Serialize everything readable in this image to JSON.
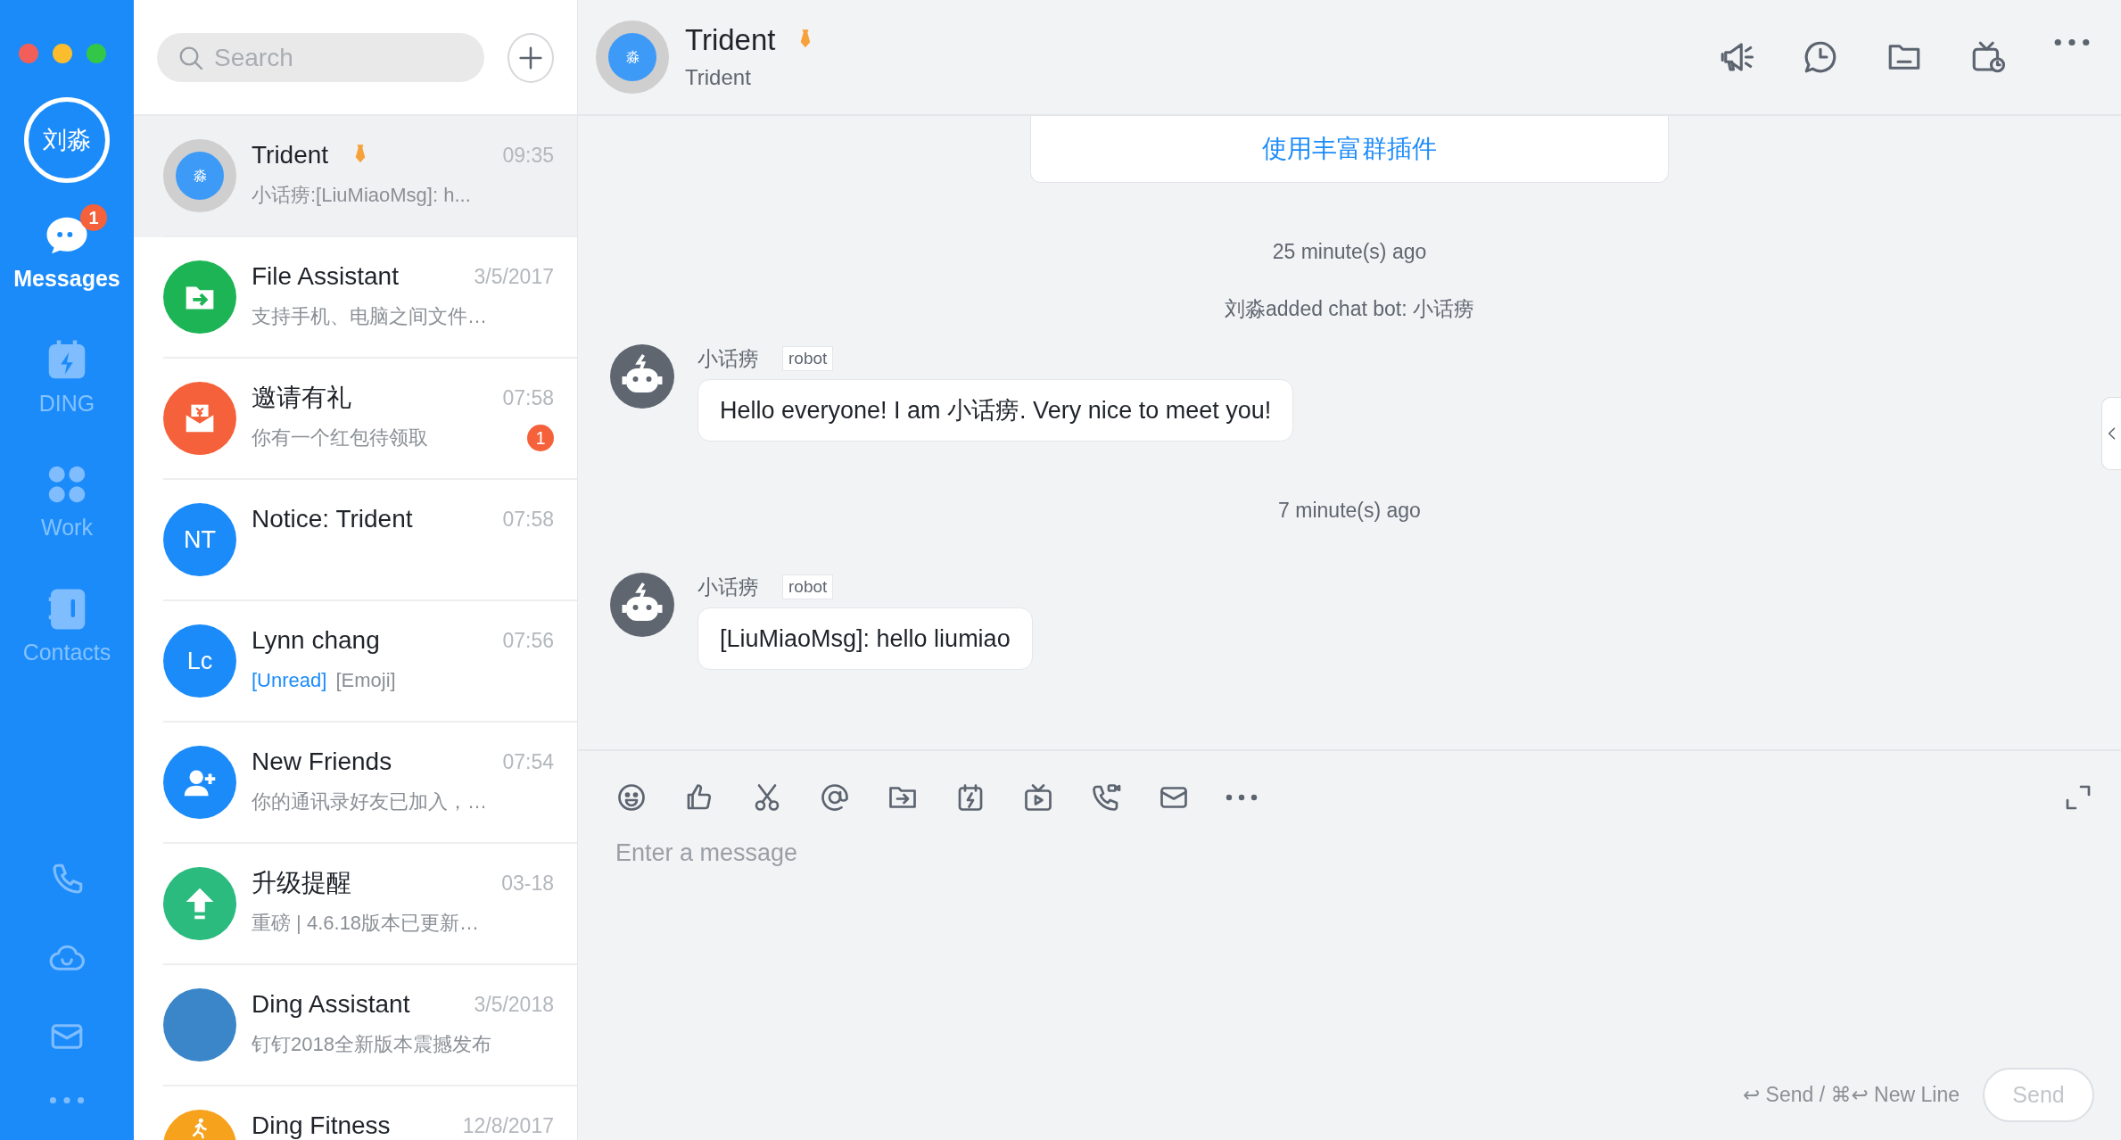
{
  "sidebar": {
    "user_avatar": "刘淼",
    "items": [
      {
        "kind": "messages",
        "label": "Messages",
        "badge": "1",
        "selected": true
      },
      {
        "kind": "ding",
        "label": "DING",
        "selected": false
      },
      {
        "kind": "work",
        "label": "Work",
        "selected": false
      },
      {
        "kind": "contacts",
        "label": "Contacts",
        "selected": false
      }
    ]
  },
  "search": {
    "placeholder": "Search"
  },
  "conversations": [
    {
      "kind": "group",
      "avatar_text": "淼",
      "color": "#3d9bf7",
      "name": "Trident",
      "marked": true,
      "time": "09:35",
      "preview": "小话痨:[LiuMiaoMsg]: h...",
      "selected": true
    },
    {
      "kind": "file",
      "color": "#1db455",
      "name": "File Assistant",
      "marked": false,
      "time": "3/5/2017",
      "preview": "支持手机、电脑之间文件…",
      "selected": false
    },
    {
      "kind": "gift",
      "color": "#f5613a",
      "name": "邀请有礼",
      "marked": false,
      "time": "07:58",
      "preview": "你有一个红包待领取",
      "badge": "1",
      "selected": false
    },
    {
      "kind": "initials",
      "avatar_text": "NT",
      "color": "#1b8bfa",
      "name": "Notice: Trident",
      "marked": false,
      "time": "07:58",
      "selected": false
    },
    {
      "kind": "initials",
      "avatar_text": "Lc",
      "color": "#1b8bfa",
      "name": "Lynn chang",
      "marked": false,
      "time": "07:56",
      "preview_tag": "[Unread]",
      "preview": "[Emoji]",
      "selected": false
    },
    {
      "kind": "add-friend",
      "color": "#1b8bfa",
      "name": "New Friends",
      "marked": false,
      "time": "07:54",
      "preview": "你的通讯录好友已加入，…",
      "selected": false
    },
    {
      "kind": "upgrade",
      "color": "#2bbb7f",
      "name": "升级提醒",
      "marked": false,
      "time": "03-18",
      "preview": "重磅 | 4.6.18版本已更新…",
      "selected": false
    },
    {
      "kind": "photo",
      "color": "#3a86c8",
      "name": "Ding Assistant",
      "marked": false,
      "time": "3/5/2018",
      "preview": "钉钉2018全新版本震撼发布",
      "selected": false
    },
    {
      "kind": "fitness",
      "color": "#f7a21d",
      "name": "Ding Fitness",
      "marked": false,
      "time": "12/8/2017",
      "selected": false
    }
  ],
  "chat": {
    "avatar_text": "淼",
    "title": "Trident",
    "marked": true,
    "subtitle": "Trident",
    "plugin_banner": "使用丰富群插件",
    "messages": [
      {
        "kind": "time",
        "text": "25 minute(s) ago"
      },
      {
        "kind": "system",
        "text": "刘淼added chat bot: 小话痨"
      },
      {
        "kind": "bubble",
        "sender": "小话痨",
        "tag": "robot",
        "text": "Hello everyone! I am 小话痨. Very nice to meet you!"
      },
      {
        "kind": "time",
        "text": "7 minute(s) ago"
      },
      {
        "kind": "bubble",
        "sender": "小话痨",
        "tag": "robot",
        "text": "[LiuMiaoMsg]: hello liumiao"
      }
    ]
  },
  "composer": {
    "placeholder": "Enter a message",
    "hint": "↩ Send / ⌘↩ New Line",
    "send_button": "Send",
    "send_disabled": true
  }
}
